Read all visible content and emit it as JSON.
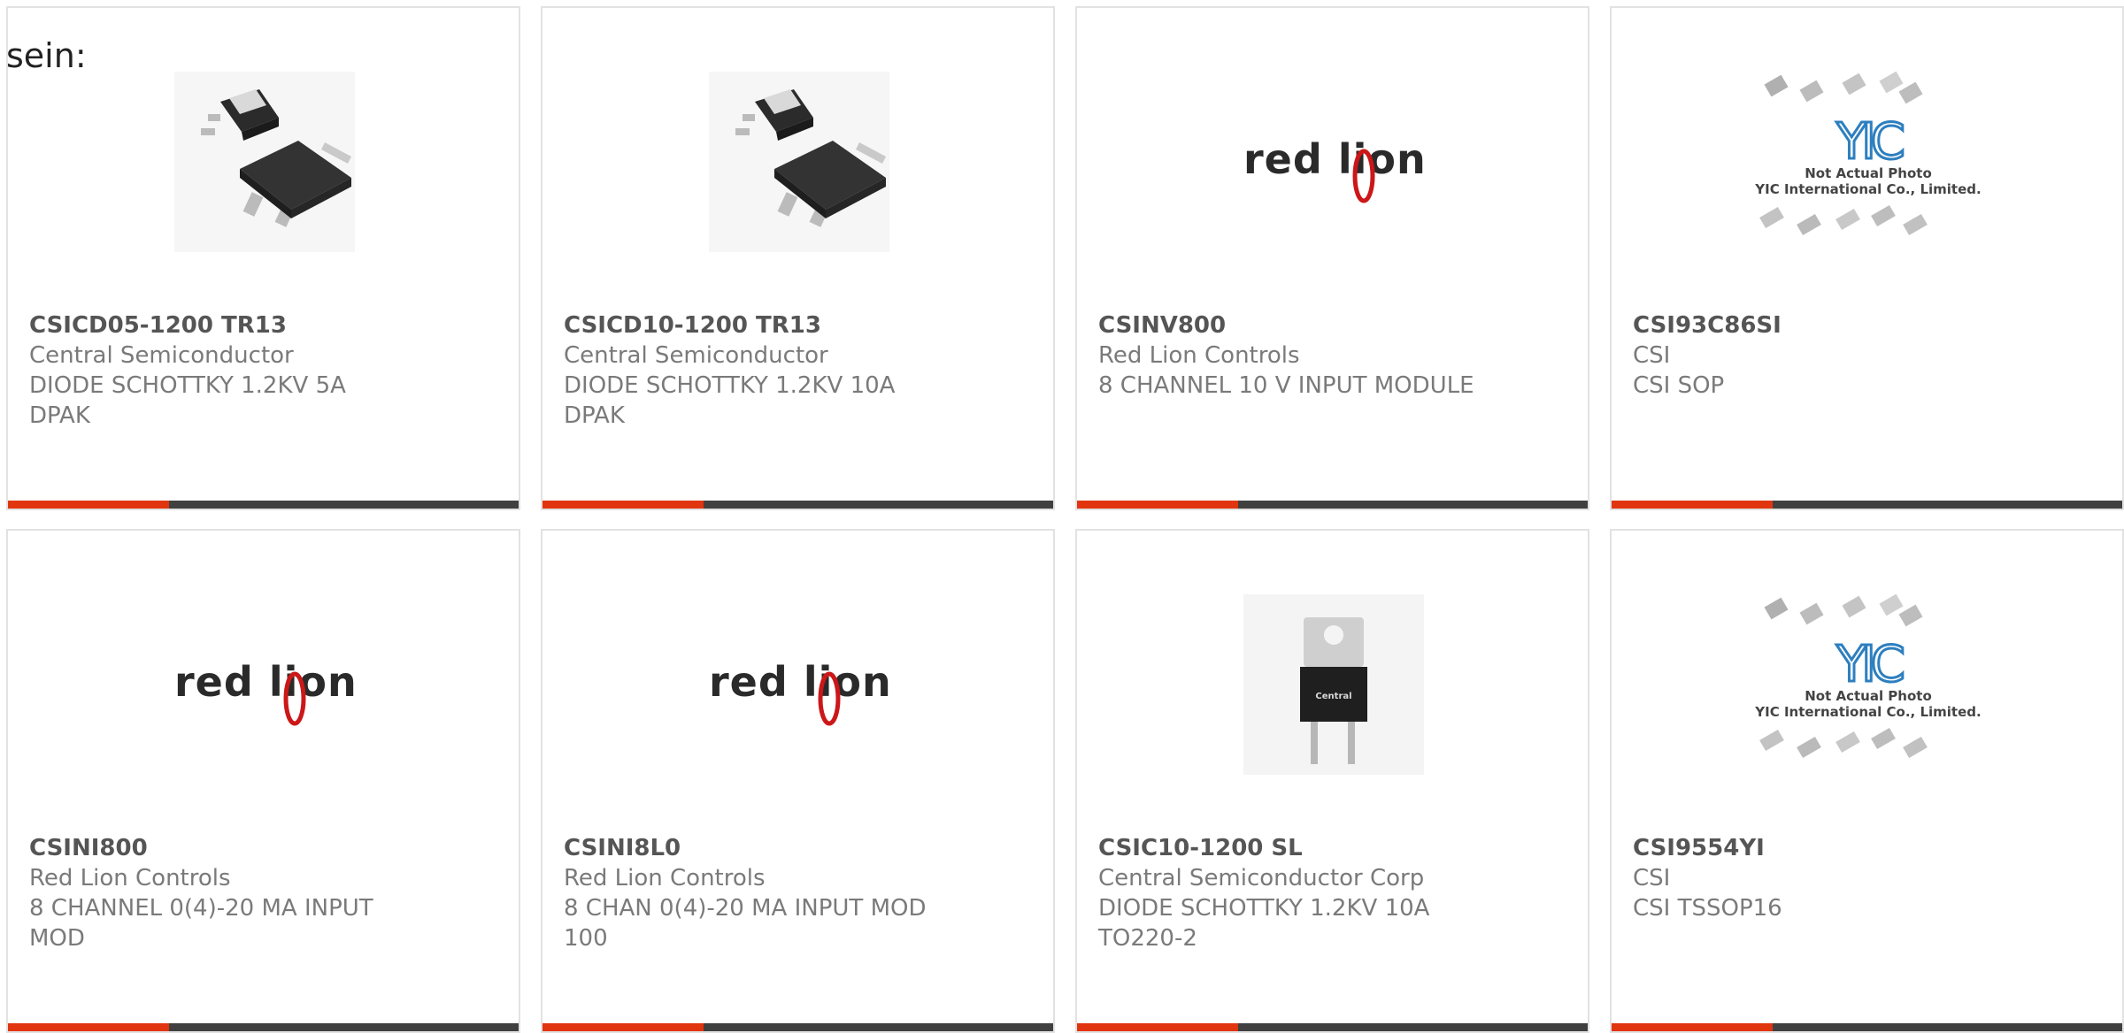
{
  "lead_text": "sein:",
  "colors": {
    "accent": "#e1350f",
    "bar": "#404040",
    "border": "#e2e2e2"
  },
  "products": [
    {
      "part": "CSICD05-1200 TR13",
      "manufacturer": "Central Semiconductor",
      "desc1": "DIODE SCHOTTKY 1.2KV 5A",
      "desc2": "DPAK",
      "image": "dpak-package-photo"
    },
    {
      "part": "CSICD10-1200 TR13",
      "manufacturer": "Central Semiconductor",
      "desc1": "DIODE SCHOTTKY 1.2KV 10A",
      "desc2": "DPAK",
      "image": "dpak-package-photo"
    },
    {
      "part": "CSINV800",
      "manufacturer": "Red Lion Controls",
      "desc1": "8 CHANNEL 10 V INPUT MODULE",
      "desc2": "",
      "image": "red-lion-logo",
      "logo_text": "red lion"
    },
    {
      "part": "CSI93C86SI",
      "manufacturer": "CSI",
      "desc1": "CSI SOP",
      "desc2": "",
      "image": "yic-placeholder",
      "placeholder_line1": "Not Actual Photo",
      "placeholder_line2": "YIC International Co., Limited.",
      "placeholder_logo": "YIC"
    },
    {
      "part": "CSINI800",
      "manufacturer": "Red Lion Controls",
      "desc1": "8 CHANNEL 0(4)-20 MA INPUT",
      "desc2": "MOD",
      "image": "red-lion-logo",
      "logo_text": "red lion"
    },
    {
      "part": "CSINI8L0",
      "manufacturer": "Red Lion Controls",
      "desc1": "8 CHAN 0(4)-20 MA INPUT MOD",
      "desc2": "100",
      "image": "red-lion-logo",
      "logo_text": "red lion"
    },
    {
      "part": "CSIC10-1200 SL",
      "manufacturer": "Central Semiconductor Corp",
      "desc1": "DIODE SCHOTTKY 1.2KV 10A",
      "desc2": "TO220-2",
      "image": "to220-package-photo",
      "chip_text": "Central"
    },
    {
      "part": "CSI9554YI",
      "manufacturer": "CSI",
      "desc1": "CSI TSSOP16",
      "desc2": "",
      "image": "yic-placeholder",
      "placeholder_line1": "Not Actual Photo",
      "placeholder_line2": "YIC International Co., Limited.",
      "placeholder_logo": "YIC"
    }
  ]
}
